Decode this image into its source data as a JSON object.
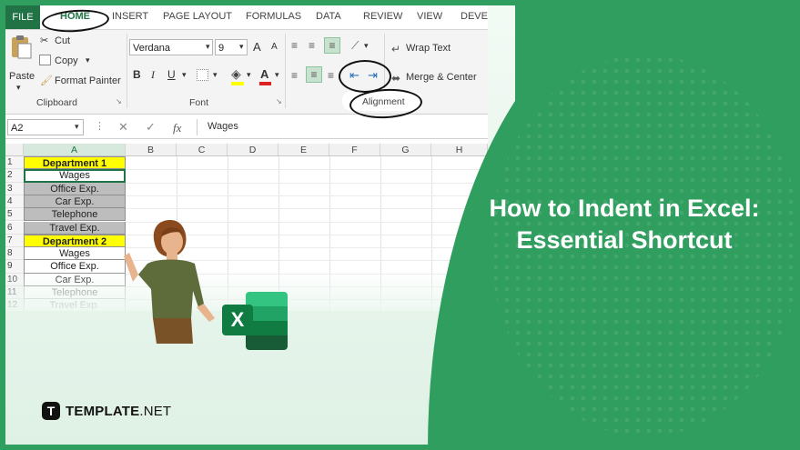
{
  "ribbon_tabs": [
    "FILE",
    "HOME",
    "INSERT",
    "PAGE LAYOUT",
    "FORMULAS",
    "DATA",
    "REVIEW",
    "VIEW",
    "DEVELO"
  ],
  "clipboard": {
    "cut": "Cut",
    "copy": "Copy",
    "paste": "Paste",
    "format_painter": "Format Painter",
    "group": "Clipboard"
  },
  "font": {
    "name": "Verdana",
    "size": "9",
    "bold": "B",
    "italic": "I",
    "underline": "U",
    "grow": "A",
    "shrink": "A",
    "color_a": "A",
    "group": "Font"
  },
  "alignment": {
    "wrap_text": "Wrap Text",
    "merge_center": "Merge & Center",
    "group": "Alignment"
  },
  "formula_bar": {
    "name_box": "A2",
    "fx": "fx",
    "cancel": "✕",
    "enter": "✓",
    "value": "Wages"
  },
  "columns": [
    "A",
    "B",
    "C",
    "D",
    "E",
    "F",
    "G",
    "H"
  ],
  "rows": [
    {
      "num": "1",
      "text": "Department 1"
    },
    {
      "num": "2",
      "text": "Wages"
    },
    {
      "num": "3",
      "text": "Office Exp."
    },
    {
      "num": "4",
      "text": "Car Exp."
    },
    {
      "num": "5",
      "text": "Telephone"
    },
    {
      "num": "6",
      "text": "Travel Exp."
    },
    {
      "num": "7",
      "text": "Department 2"
    },
    {
      "num": "8",
      "text": "Wages"
    },
    {
      "num": "9",
      "text": "Office Exp."
    },
    {
      "num": "10",
      "text": "Car Exp."
    },
    {
      "num": "11",
      "text": "Telephone"
    },
    {
      "num": "12",
      "text": "Travel Exp."
    }
  ],
  "headline": {
    "line1": "How to Indent in Excel:",
    "line2": "Essential Shortcut"
  },
  "brand": {
    "mark": "T",
    "name": "TEMPLATE",
    "suffix": ".NET"
  },
  "excel_logo_letter": "X",
  "colors": {
    "excel_green": "#217346",
    "brand_green": "#2f9e5e",
    "yellow": "#ffff00",
    "gray_cell": "#bdbdbd"
  }
}
